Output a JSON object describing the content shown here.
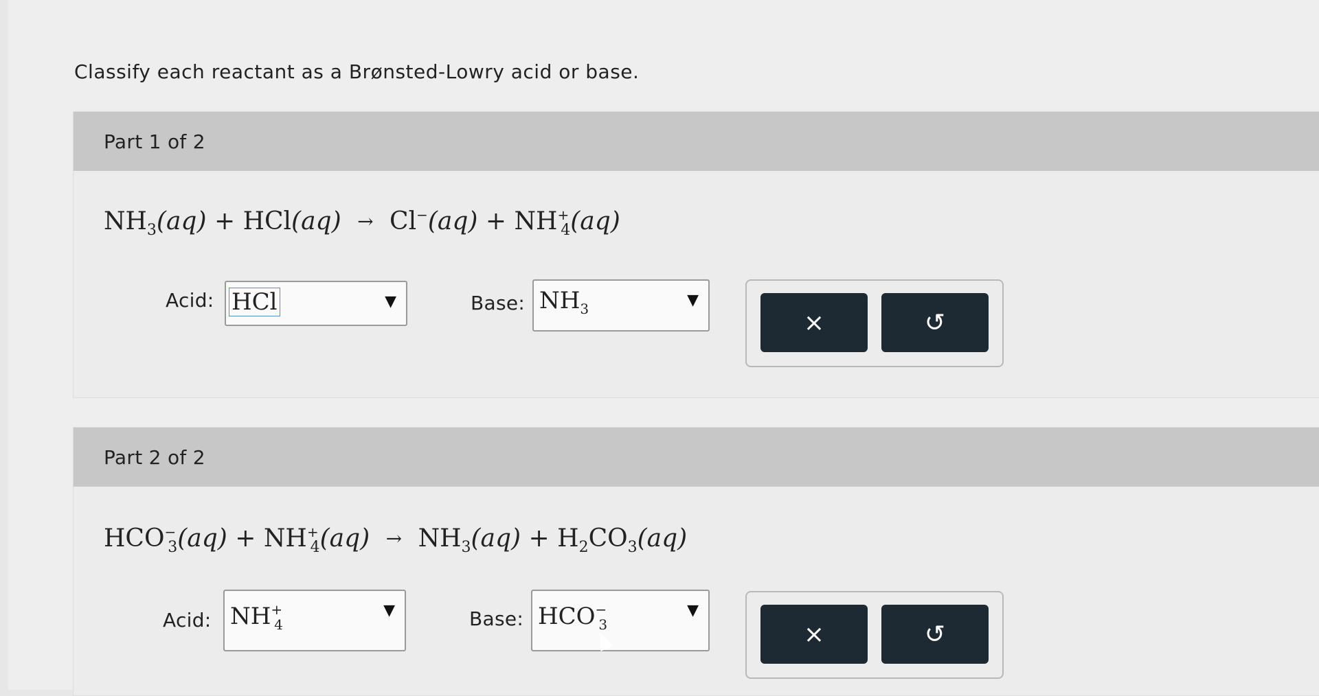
{
  "prompt": "Classify each reactant as a Brønsted-Lowry acid or base.",
  "parts": [
    {
      "header": "Part 1 of 2",
      "equation": {
        "r1": "NH",
        "r1_sub": "3",
        "r1_state": "(aq)",
        "plus1": "+",
        "r2": "HCl",
        "r2_state": "(aq)",
        "arrow": "→",
        "p1": "Cl",
        "p1_charge": "−",
        "p1_state": "(aq)",
        "plus2": "+",
        "p2": "NH",
        "p2_sub": "4",
        "p2_charge": "+",
        "p2_state": "(aq)"
      },
      "acid_label": "Acid:",
      "acid_value": "HCl",
      "acid_value_sub": "",
      "acid_value_charge": "",
      "base_label": "Base:",
      "base_value": "NH",
      "base_value_sub": "3",
      "base_value_charge": "",
      "clear_icon": "×",
      "reset_icon": "↺"
    },
    {
      "header": "Part 2 of 2",
      "equation": {
        "r1": "HCO",
        "r1_sub": "3",
        "r1_charge": "−",
        "r1_state": "(aq)",
        "plus1": "+",
        "r2": "NH",
        "r2_sub": "4",
        "r2_charge": "+",
        "r2_state": "(aq)",
        "arrow": "→",
        "p1": "NH",
        "p1_sub": "3",
        "p1_state": "(aq)",
        "plus2": "+",
        "p2a": "H",
        "p2a_sub": "2",
        "p2b": "CO",
        "p2b_sub": "3",
        "p2_state": "(aq)"
      },
      "acid_label": "Acid:",
      "acid_value": "NH",
      "acid_value_sub": "4",
      "acid_value_charge": "+",
      "base_label": "Base:",
      "base_value": "HCO",
      "base_value_sub": "3",
      "base_value_charge": "−",
      "clear_icon": "×",
      "reset_icon": "↺"
    }
  ],
  "colors": {
    "button_bg": "#1e2a33",
    "header_bg": "#c7c7c7",
    "page_bg": "#eeeeee"
  }
}
